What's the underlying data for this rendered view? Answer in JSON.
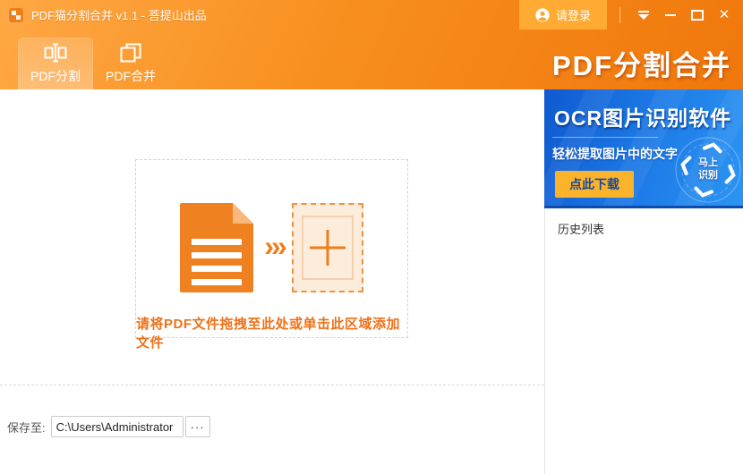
{
  "window": {
    "title": "PDF猫分割合并 v1.1 - 菩提山出品"
  },
  "titlebar": {
    "login_label": "请登录",
    "close_icon": "✕"
  },
  "tabs": [
    {
      "label": "PDF分割",
      "active": true
    },
    {
      "label": "PDF合并",
      "active": false
    }
  ],
  "header": {
    "brand_title": "PDF分割合并"
  },
  "main": {
    "transfer_icon": "›»",
    "dropzone_caption": "请将PDF文件拖拽至此处或单击此区域添加文件",
    "save_label": "保存至:",
    "save_path": "C:\\Users\\Administrator",
    "browse_label": "···"
  },
  "sidebar": {
    "ad": {
      "title": "OCR图片识别软件",
      "subtitle": "轻松提取图片中的文字",
      "download_label": "点此下载",
      "badge_label_line1": "马上",
      "badge_label_line2": "识别"
    },
    "history_label": "历史列表"
  },
  "colors": {
    "header_orange": "#f78f1e",
    "accent_orange": "#f08121",
    "caption_orange": "#ee7118",
    "ad_blue": "#1e7ce8",
    "download_yellow": "#fcb32c",
    "download_text_blue": "#17499c"
  }
}
